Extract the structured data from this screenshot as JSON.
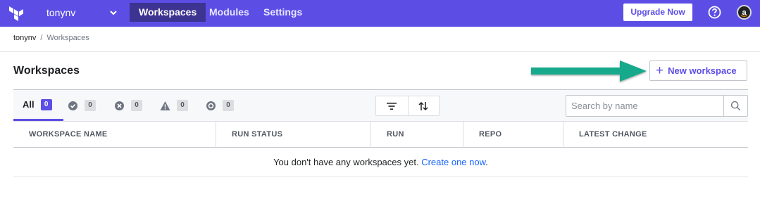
{
  "nav": {
    "org_name": "tonynv",
    "items": [
      {
        "label": "Workspaces",
        "active": true
      },
      {
        "label": "Modules",
        "active": false
      },
      {
        "label": "Settings",
        "active": false
      }
    ],
    "upgrade_label": "Upgrade Now",
    "accent_color": "#5c4ee5"
  },
  "breadcrumb": {
    "org": "tonynv",
    "separator": "/",
    "current": "Workspaces"
  },
  "header": {
    "title": "Workspaces",
    "new_workspace_label": "New workspace"
  },
  "filters": {
    "all_label": "All",
    "all_count": "0",
    "statuses": [
      {
        "icon": "check-circle-icon",
        "count": "0"
      },
      {
        "icon": "x-circle-icon",
        "count": "0"
      },
      {
        "icon": "warning-icon",
        "count": "0"
      },
      {
        "icon": "pending-circle-icon",
        "count": "0"
      }
    ],
    "search_placeholder": "Search by name"
  },
  "table": {
    "columns": [
      "WORKSPACE NAME",
      "RUN STATUS",
      "RUN",
      "REPO",
      "LATEST CHANGE"
    ],
    "empty_text": "You don't have any workspaces yet.",
    "empty_link": "Create one now",
    "empty_suffix": "."
  }
}
